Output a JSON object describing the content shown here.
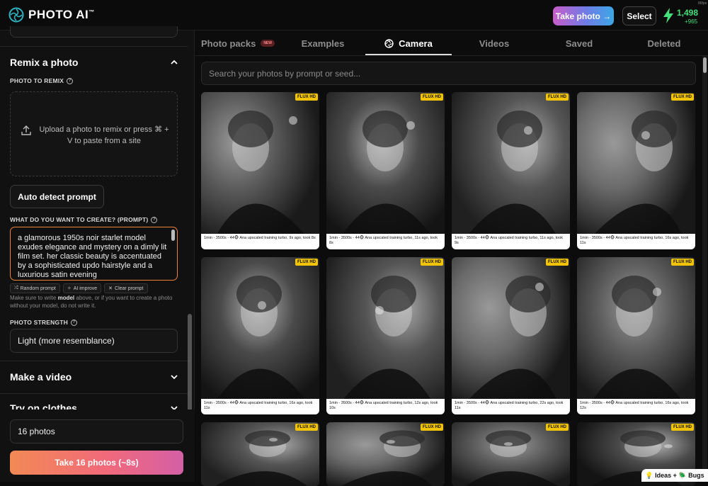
{
  "header": {
    "logo_text": "PHOTO AI",
    "logo_tm": "™",
    "take_photo_label": "Take photo →",
    "select_label": "Select",
    "credits": "1,498",
    "credits_delta": "+965",
    "fps": "86fps"
  },
  "sidebar": {
    "remix_title": "Remix a photo",
    "photo_to_remix_label": "PHOTO TO REMIX",
    "upload_text": "Upload a photo to remix or press ⌘ + V to paste from a site",
    "auto_detect_label": "Auto detect prompt",
    "prompt_label": "WHAT DO YOU WANT TO CREATE? (PROMPT)",
    "prompt_value": "a glamorous 1950s noir starlet model exudes elegance and mystery on a dimly lit film set. her classic beauty is accentuated by a sophisticated updo hairstyle and a luxurious satin evening",
    "chips": [
      "Random prompt",
      "AI improve",
      "Clear prompt"
    ],
    "hint_prefix": "Make sure to write ",
    "hint_bold": "model",
    "hint_suffix": " above, or if you want to create a photo without your model, do not write it.",
    "strength_label": "PHOTO STRENGTH",
    "strength_value": "Light (more resemblance)",
    "make_video_title": "Make a video",
    "try_on_title": "Try on clothes",
    "photos_count": "16 photos",
    "take_button": "Take 16 photos (~8s)"
  },
  "tabs": [
    {
      "label": "Photo packs",
      "badge": "NEW"
    },
    {
      "label": "Examples"
    },
    {
      "label": "Camera"
    },
    {
      "label": "Videos"
    },
    {
      "label": "Saved"
    },
    {
      "label": "Deleted"
    }
  ],
  "search_placeholder": "Search your photos by prompt or seed...",
  "photos": [
    {
      "badge": "FLUX HD",
      "caption": "1min - 3500s - 44🐵 Ana upscaled training turbo, 9s ago, took 8s"
    },
    {
      "badge": "FLUX HD",
      "caption": "1min - 3500s - 44🐵 Ana upscaled training turbo, 11s ago, took 8s"
    },
    {
      "badge": "FLUX HD",
      "caption": "1min - 3500s - 44🐵 Ana upscaled training turbo, 11s ago, took 9s"
    },
    {
      "badge": "FLUX HD",
      "caption": "1min - 3500s - 44🐵 Ana upscaled training turbo, 16s ago, took 11s"
    },
    {
      "badge": "FLUX HD",
      "caption": "1min - 3500s - 44🐵 Ana upscaled training turbo, 16s ago, took 11s"
    },
    {
      "badge": "FLUX HD",
      "caption": "1min - 3500s - 44🐵 Ana upscaled training turbo, 12s ago, took 10s"
    },
    {
      "badge": "FLUX HD",
      "caption": "1min - 3500s - 44🐵 Ana upscaled training turbo, 22s ago, took 11s"
    },
    {
      "badge": "FLUX HD",
      "caption": "1min - 3500s - 44🐵 Ana upscaled training turbo, 16s ago, took 12s"
    },
    {
      "badge": "FLUX HD",
      "caption": ""
    },
    {
      "badge": "FLUX HD",
      "caption": ""
    },
    {
      "badge": "FLUX HD",
      "caption": ""
    },
    {
      "badge": "FLUX HD",
      "caption": ""
    }
  ],
  "ideas_label": "💡 Ideas + 🪲 Bugs",
  "colors": {
    "accent_orange": "#f0833a",
    "credit_green": "#45e07a",
    "flux_badge": "#f2c400"
  }
}
